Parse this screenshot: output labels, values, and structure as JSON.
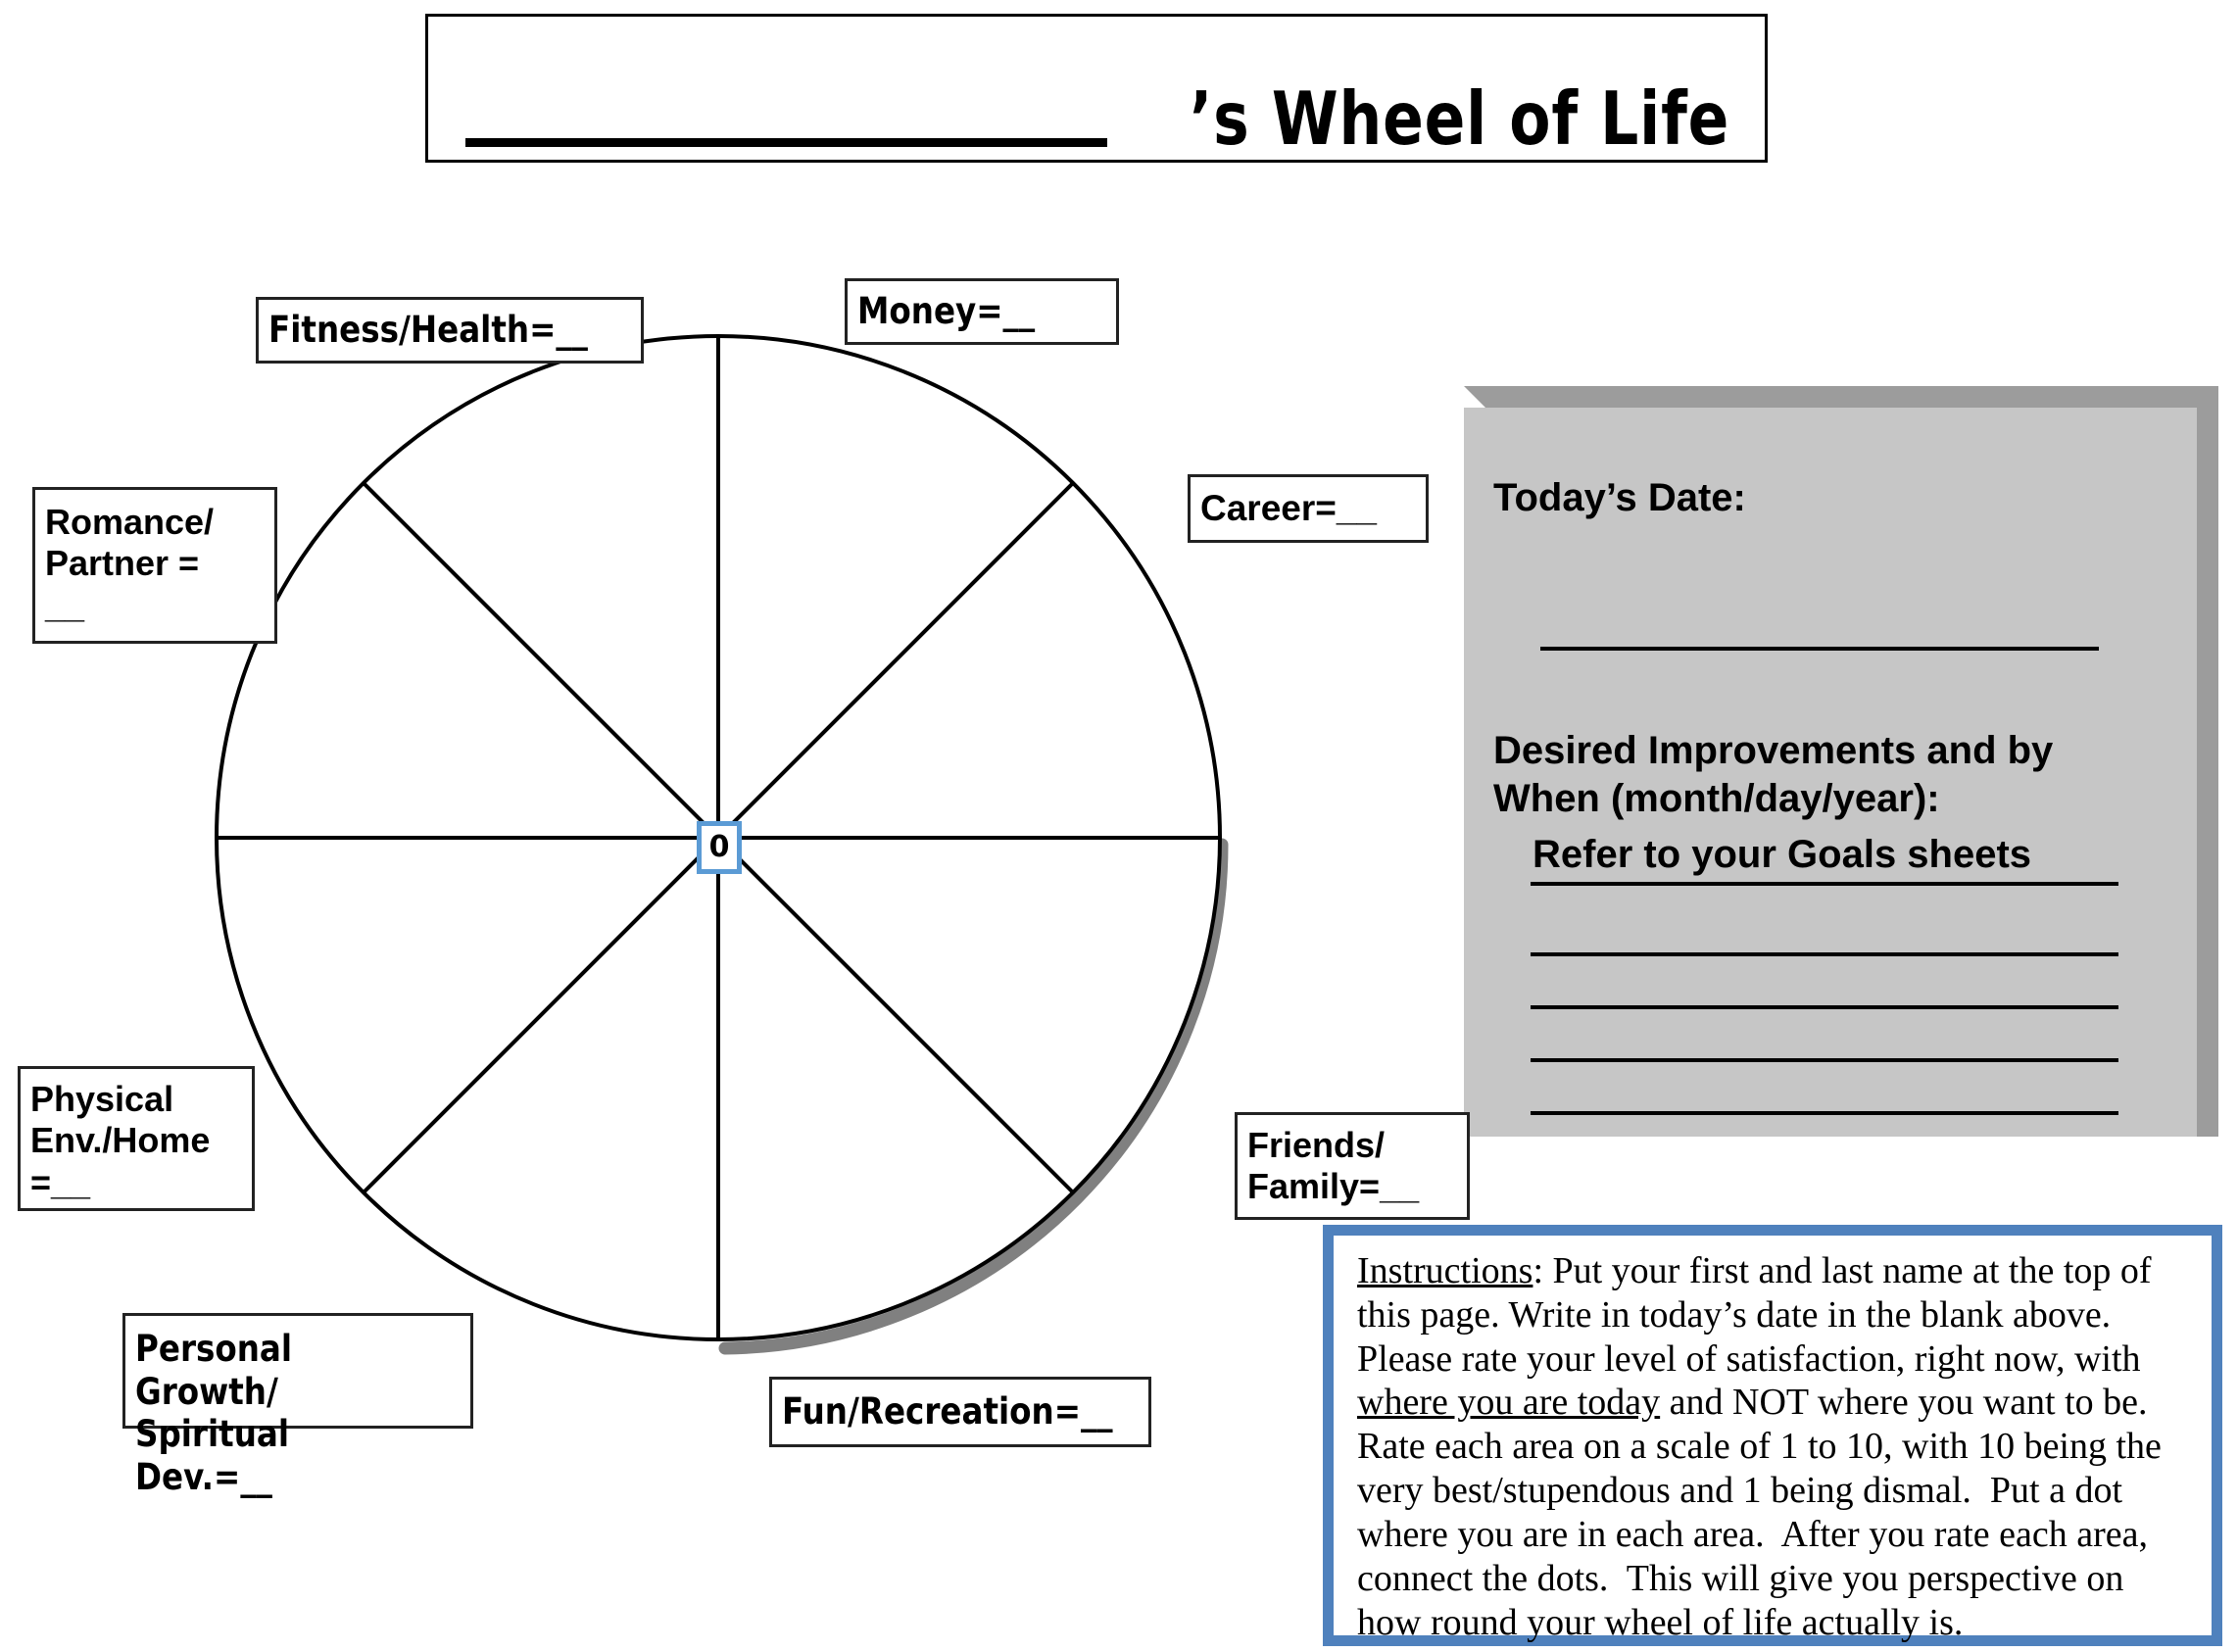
{
  "title": {
    "text": "’s Wheel of Life",
    "name_blank": ""
  },
  "wheel": {
    "center_value": "0",
    "spoke_labels": [
      {
        "id": "fitness",
        "text": "Fitness/Health=__"
      },
      {
        "id": "money",
        "text": "Money=__"
      },
      {
        "id": "career",
        "text": "Career=__"
      },
      {
        "id": "romance",
        "text": "Romance/\nPartner  =\n__"
      },
      {
        "id": "physical",
        "text": "Physical\nEnv./Home\n=__"
      },
      {
        "id": "friends",
        "text": "Friends/\nFamily=__"
      },
      {
        "id": "growth",
        "text": "Personal Growth/\nSpiritual Dev.=__"
      },
      {
        "id": "fun",
        "text": "Fun/Recreation=__"
      }
    ]
  },
  "date_panel": {
    "date_label": "Today’s Date:",
    "improvements_label": "Desired Improvements and by\nWhen (month/day/year):",
    "goals_note": "Refer to your Goals sheets",
    "blank_line_count": 4,
    "background_color": "#c6c6c6",
    "bevel_color": "#9c9c9c"
  },
  "instructions": {
    "heading": "Instructions",
    "border_color": "#4F81BD",
    "lines": [
      {
        "segments": [
          {
            "text": "Instructions",
            "underline": true
          },
          {
            "text": ": Put your first and last name at the top of",
            "underline": false
          }
        ]
      },
      {
        "segments": [
          {
            "text": "this page. Write in today’s date in the blank above.",
            "underline": false
          }
        ]
      },
      {
        "segments": [
          {
            "text": "Please rate your level of satisfaction, right now, with",
            "underline": false
          }
        ]
      },
      {
        "segments": [
          {
            "text": "where you are today",
            "underline": true
          },
          {
            "text": " and NOT where you want to be.",
            "underline": false
          }
        ]
      },
      {
        "segments": [
          {
            "text": "Rate each area on a scale of 1 to 10, with 10 being the",
            "underline": false
          }
        ]
      },
      {
        "segments": [
          {
            "text": "very best/stupendous and 1 being dismal.  Put a dot",
            "underline": false
          }
        ]
      },
      {
        "segments": [
          {
            "text": "where you are in each area.  After you rate each area,",
            "underline": false
          }
        ]
      },
      {
        "segments": [
          {
            "text": "connect the dots.  This will give you perspective on",
            "underline": false
          }
        ]
      },
      {
        "segments": [
          {
            "text": "how round your wheel of life actually is.",
            "underline": false
          }
        ]
      }
    ]
  },
  "colors": {
    "accent_blue": "#4F81BD",
    "center_blue": "#5B9BD5",
    "panel_gray": "#c6c6c6",
    "shadow_gray": "#808080"
  }
}
